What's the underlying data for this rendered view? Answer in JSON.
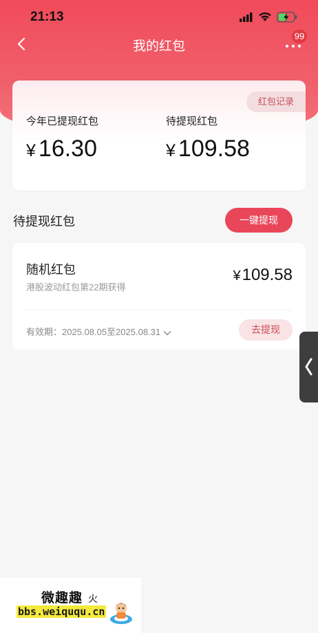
{
  "status_bar": {
    "time": "21:13"
  },
  "nav": {
    "title": "我的红包",
    "badge": "99"
  },
  "summary": {
    "record_label": "红包记录",
    "withdrawn_label": "今年已提现红包",
    "withdrawn_currency": "¥",
    "withdrawn_value": "16.30",
    "pending_label": "待提现红包",
    "pending_currency": "¥",
    "pending_value": "109.58"
  },
  "section": {
    "title": "待提现红包",
    "withdraw_all_label": "一键提现"
  },
  "envelope": {
    "type": "随机红包",
    "source": "港股波动红包第22期获得",
    "currency": "¥",
    "amount": "109.58",
    "validity": "有效期：2025.08.05至2025.08.31",
    "withdraw_label": "去提现"
  },
  "watermark": {
    "name": "微趣趣",
    "url": "bbs.weiququ.cn",
    "char": "火"
  },
  "colors": {
    "brand": "#f14a5a",
    "button": "#e9465a",
    "badge": "#e23a42"
  }
}
